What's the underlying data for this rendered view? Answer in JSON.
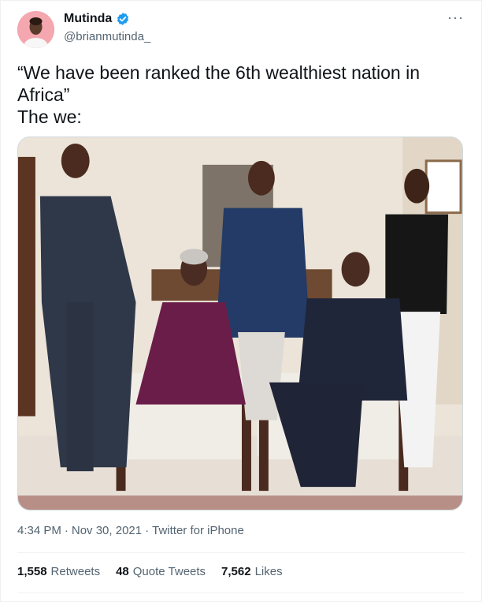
{
  "tweet": {
    "author": {
      "display_name": "Mutinda",
      "handle": "@brianmutinda_",
      "verified_icon": "verified-badge-icon",
      "verified_color": "#1d9bf0"
    },
    "more_menu_icon": "more-horizontal-icon",
    "text": "“We have been ranked the 6th wealthiest nation in Africa”\nThe we:",
    "media": {
      "kind": "photo"
    },
    "meta": {
      "time": "4:34 PM",
      "separator": "·",
      "date": "Nov 30, 2021",
      "source": "Twitter for iPhone"
    },
    "stats": {
      "retweets_count": "1,558",
      "retweets_label": "Retweets",
      "quote_count": "48",
      "quote_label": "Quote Tweets",
      "likes_count": "7,562",
      "likes_label": "Likes"
    }
  }
}
